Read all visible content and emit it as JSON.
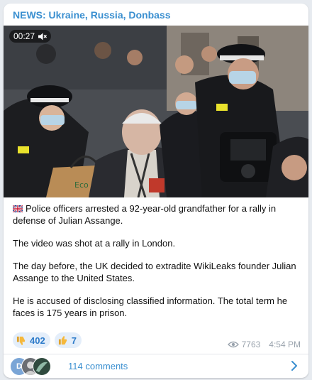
{
  "post": {
    "channel": "NEWS: Ukraine, Russia, Donbass",
    "video_duration": "00:27",
    "caption": [
      "Police officers arrested a 92-year-old grandfather for a rally in defense of Julian Assange.",
      "The video was shot at a rally in London.",
      "The day before, the UK decided to extradite WikiLeaks founder Julian Assange to the United States.",
      "He is accused of disclosing classified information. The total term he faces is 175 years in prison."
    ],
    "caption_flag": "uk-flag-icon",
    "reactions": [
      {
        "icon": "thumbs-down-icon",
        "count": "402"
      },
      {
        "icon": "thumbs-up-icon",
        "count": "7"
      }
    ],
    "views": "7763",
    "time": "4:54 PM",
    "avatar_letter": "D",
    "comments_label": "114 comments"
  },
  "colors": {
    "link": "#3a8fd0",
    "reaction_bg": "#e4eefa",
    "meta": "#9aa3ad"
  }
}
